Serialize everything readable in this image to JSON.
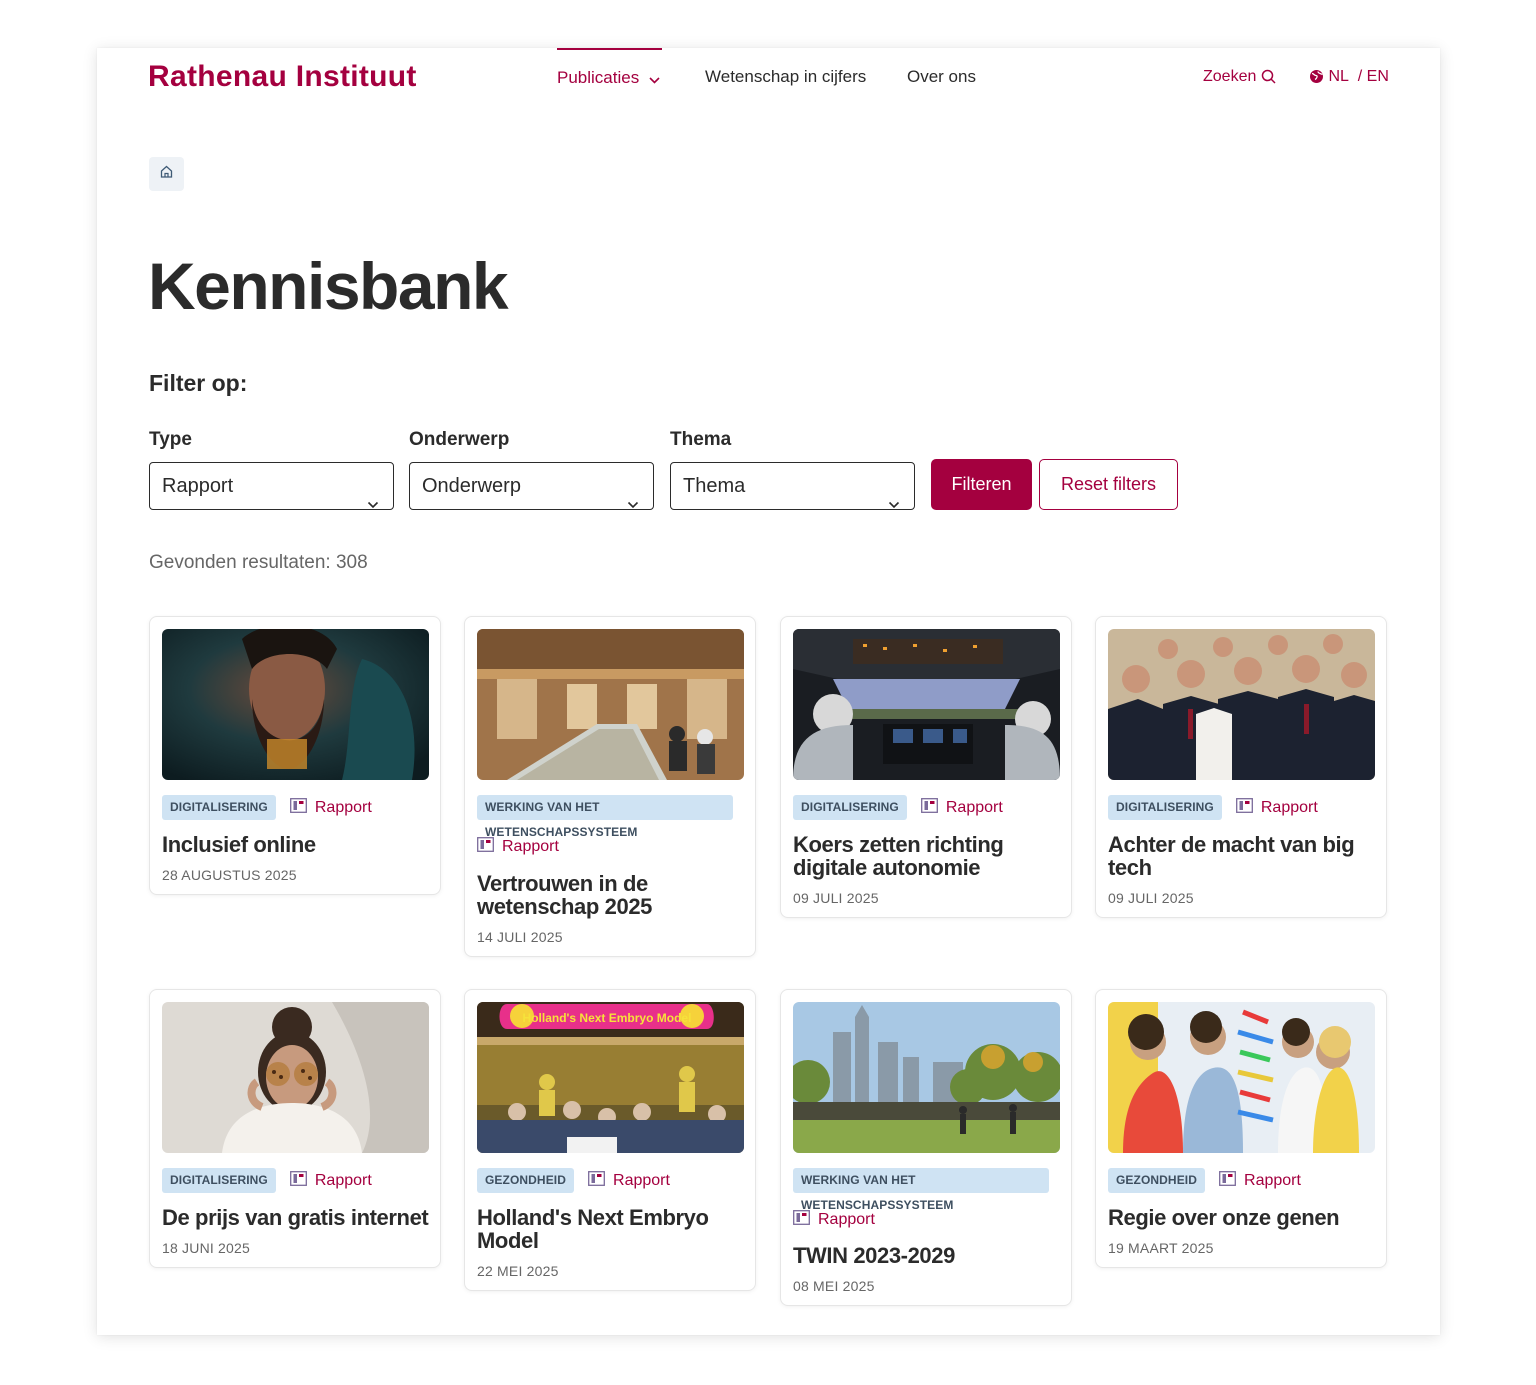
{
  "header": {
    "logo": "Rathenau Instituut",
    "nav": [
      {
        "label": "Publicaties"
      },
      {
        "label": "Wetenschap in cijfers"
      },
      {
        "label": "Over ons"
      }
    ],
    "search_label": "Zoeken",
    "lang_nl": "NL",
    "lang_en": "/ EN"
  },
  "page": {
    "title": "Kennisbank",
    "filter_heading": "Filter op:",
    "filters": [
      {
        "label": "Type",
        "value": "Rapport"
      },
      {
        "label": "Onderwerp",
        "value": "Onderwerp"
      },
      {
        "label": "Thema",
        "value": "Thema"
      }
    ],
    "filter_button": "Filteren",
    "reset_button": "Reset filters",
    "results": "Gevonden resultaten: 308"
  },
  "colors": {
    "accent": "#a4003f",
    "tag_bg": "#cfe3f3",
    "text": "#2b2b2b"
  },
  "cards": [
    {
      "tag": "DIGITALISERING",
      "type": "Rapport",
      "title": "Inclusief online",
      "date": "28 AUGUSTUS 2025",
      "image": "man-face-portrait"
    },
    {
      "tag": "WERKING VAN HET WETENSCHAPSSYSTEEM",
      "type": "Rapport",
      "title": "Vertrouwen in de wetenschap 2025",
      "date": "14 JULI 2025",
      "image": "museum-hall"
    },
    {
      "tag": "DIGITALISERING",
      "type": "Rapport",
      "title": "Koers zetten richting digitale autonomie",
      "date": "09 JULI 2025",
      "image": "cockpit-pilots"
    },
    {
      "tag": "DIGITALISERING",
      "type": "Rapport",
      "title": "Achter de macht van big tech",
      "date": "09 JULI 2025",
      "image": "tech-executives-group"
    },
    {
      "tag": "DIGITALISERING",
      "type": "Rapport",
      "title": "De prijs van gratis internet",
      "date": "18 JUNI 2025",
      "image": "woman-with-cookies"
    },
    {
      "tag": "GEZONDHEID",
      "type": "Rapport",
      "title": "Holland's Next Embryo Model",
      "date": "22 MEI 2025",
      "image": "embryo-model-event",
      "image_text": "Holland's Next Embryo Model"
    },
    {
      "tag": "WERKING VAN HET WETENSCHAPSSYSTEEM",
      "type": "Rapport",
      "title": "TWIN 2023-2029",
      "date": "08 MEI 2025",
      "image": "city-skyline-park"
    },
    {
      "tag": "GEZONDHEID",
      "type": "Rapport",
      "title": "Regie over onze genen",
      "date": "19 MAART 2025",
      "image": "children-dna-model"
    }
  ]
}
